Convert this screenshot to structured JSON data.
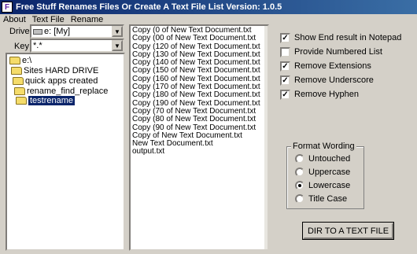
{
  "window": {
    "title": "Free Stuff Renames Files Or Create A Text File List Version: 1.0.5",
    "icon_letter": "F"
  },
  "menu": {
    "items": [
      "About",
      "Text File",
      "Rename"
    ]
  },
  "drive": {
    "label": "Drive:",
    "value": "e: [My]"
  },
  "key": {
    "label": "Key:",
    "value": "*.*"
  },
  "tree": {
    "items": [
      {
        "label": "e:\\"
      },
      {
        "label": "Sites HARD DRIVE"
      },
      {
        "label": "quick apps created"
      },
      {
        "label": "rename_find_replace"
      },
      {
        "label": "testrename"
      }
    ]
  },
  "files": [
    "Copy (0 of New Text Document.txt",
    "Copy (00 of New Text Document.txt",
    "Copy (120 of New Text Document.txt",
    "Copy (130 of New Text Document.txt",
    "Copy (140 of New Text Document.txt",
    "Copy (150 of New Text Document.txt",
    "Copy (160 of New Text Document.txt",
    "Copy (170 of New Text Document.txt",
    "Copy (180 of New Text Document.txt",
    "Copy (190 of New Text Document.txt",
    "Copy (70 of New Text Document.txt",
    "Copy (80 of New Text Document.txt",
    "Copy (90 of New Text Document.txt",
    "Copy of New Text Document.txt",
    "New Text Document.txt",
    "output.txt"
  ],
  "options": [
    {
      "label": "Show End result in Notepad",
      "checked": true
    },
    {
      "label": "Provide Numbered List",
      "checked": false
    },
    {
      "label": "Remove Extensions",
      "checked": true
    },
    {
      "label": "Remove Underscore",
      "checked": true
    },
    {
      "label": "Remove Hyphen",
      "checked": true
    }
  ],
  "format": {
    "legend": "Format Wording",
    "options": [
      {
        "label": "Untouched",
        "selected": false
      },
      {
        "label": "Uppercase",
        "selected": false
      },
      {
        "label": "Lowercase",
        "selected": true
      },
      {
        "label": "Title Case",
        "selected": false
      }
    ]
  },
  "action": {
    "button_label": "DIR TO A TEXT FILE"
  }
}
